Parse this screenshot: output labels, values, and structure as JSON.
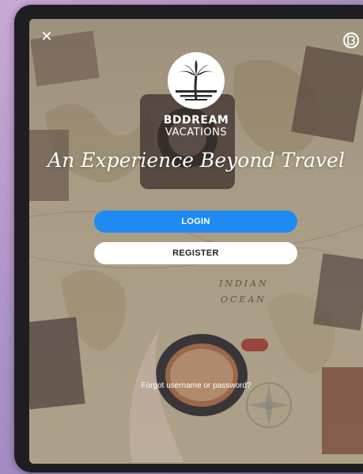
{
  "app": {
    "brand_name": "BDDREAM",
    "brand_sub": "VACATIONS",
    "tagline": "An Experience Beyond Travel"
  },
  "actions": {
    "login_label": "LOGIN",
    "register_label": "REGISTER",
    "forgot_label": "Forgot username or password?"
  },
  "map_text": {
    "ocean_line1": "INDIAN",
    "ocean_line2": "OCEAN"
  },
  "icons": {
    "close": "close-icon",
    "brand": "brand-badge-icon",
    "logo": "palm-tree-logo-icon"
  },
  "colors": {
    "login_button": "#1f8bf2",
    "register_button": "#ffffff",
    "text": "#ffffff"
  }
}
